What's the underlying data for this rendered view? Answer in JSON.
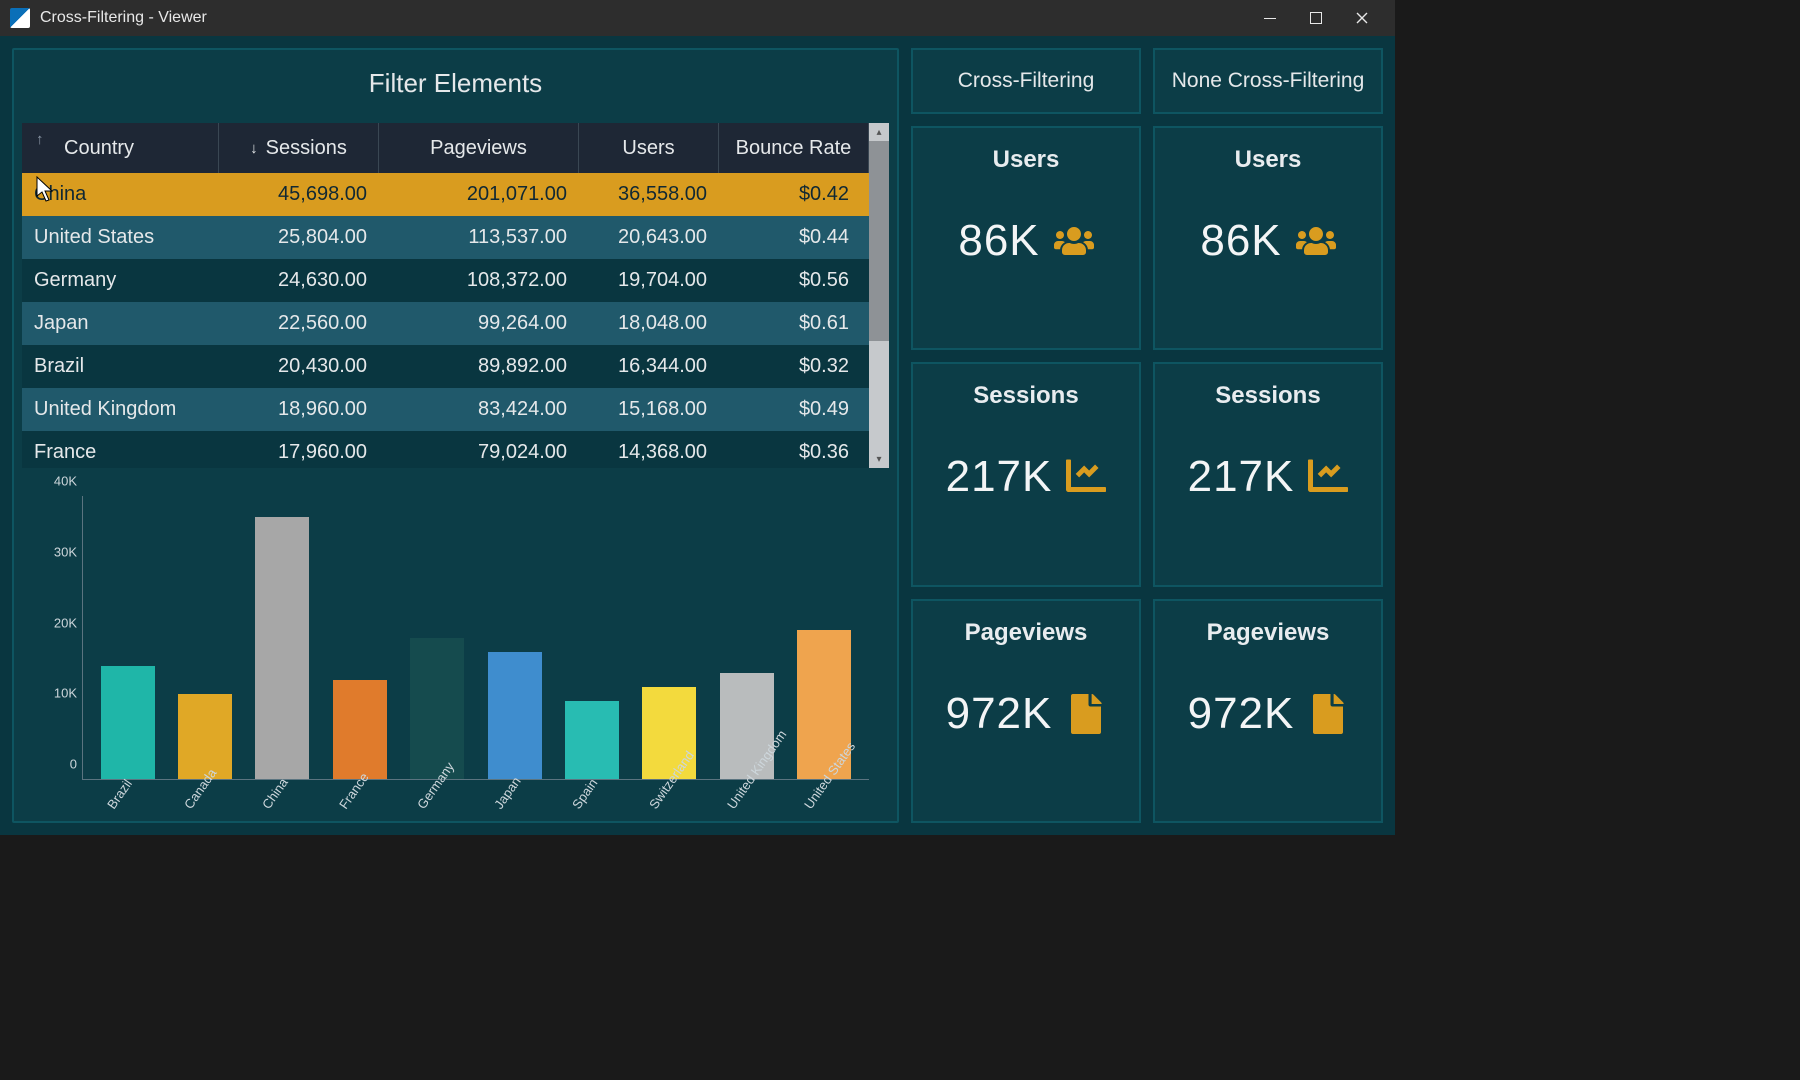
{
  "window": {
    "title": "Cross-Filtering - Viewer"
  },
  "panel": {
    "title": "Filter Elements"
  },
  "table": {
    "headers": {
      "country": "Country",
      "sessions": "Sessions",
      "pageviews": "Pageviews",
      "users": "Users",
      "bounce": "Bounce Rate"
    },
    "rows": [
      {
        "country": "China",
        "sessions": "45,698.00",
        "pageviews": "201,071.00",
        "users": "36,558.00",
        "bounce": "$0.42",
        "selected": true
      },
      {
        "country": "United States",
        "sessions": "25,804.00",
        "pageviews": "113,537.00",
        "users": "20,643.00",
        "bounce": "$0.44",
        "alt": true
      },
      {
        "country": "Germany",
        "sessions": "24,630.00",
        "pageviews": "108,372.00",
        "users": "19,704.00",
        "bounce": "$0.56"
      },
      {
        "country": "Japan",
        "sessions": "22,560.00",
        "pageviews": "99,264.00",
        "users": "18,048.00",
        "bounce": "$0.61",
        "alt": true
      },
      {
        "country": "Brazil",
        "sessions": "20,430.00",
        "pageviews": "89,892.00",
        "users": "16,344.00",
        "bounce": "$0.32"
      },
      {
        "country": "United Kingdom",
        "sessions": "18,960.00",
        "pageviews": "83,424.00",
        "users": "15,168.00",
        "bounce": "$0.49",
        "alt": true
      },
      {
        "country": "France",
        "sessions": "17,960.00",
        "pageviews": "79,024.00",
        "users": "14,368.00",
        "bounce": "$0.36"
      }
    ]
  },
  "columns": {
    "cf": {
      "header": "Cross-Filtering",
      "kpis": [
        {
          "title": "Users",
          "value": "86K"
        },
        {
          "title": "Sessions",
          "value": "217K"
        },
        {
          "title": "Pageviews",
          "value": "972K"
        }
      ]
    },
    "ncf": {
      "header": "None Cross-Filtering",
      "kpis": [
        {
          "title": "Users",
          "value": "86K"
        },
        {
          "title": "Sessions",
          "value": "217K"
        },
        {
          "title": "Pageviews",
          "value": "972K"
        }
      ]
    }
  },
  "chart_data": {
    "type": "bar",
    "title": "",
    "xlabel": "",
    "ylabel": "",
    "categories": [
      "Brazil",
      "Canada",
      "China",
      "France",
      "Germany",
      "Japan",
      "Spain",
      "Switzerland",
      "United Kingdom",
      "United States"
    ],
    "values": [
      16000,
      12000,
      37000,
      14000,
      20000,
      18000,
      11000,
      13000,
      15000,
      21000
    ],
    "colors": [
      "#1fb6a8",
      "#e0a826",
      "#a7a7a7",
      "#e07b2c",
      "#154b4e",
      "#3f8dce",
      "#28bcb2",
      "#f3da3d",
      "#b9bcbd",
      "#efa44e"
    ],
    "yticks": [
      "0",
      "10K",
      "20K",
      "30K",
      "40K"
    ],
    "ylim": [
      0,
      40000
    ]
  }
}
